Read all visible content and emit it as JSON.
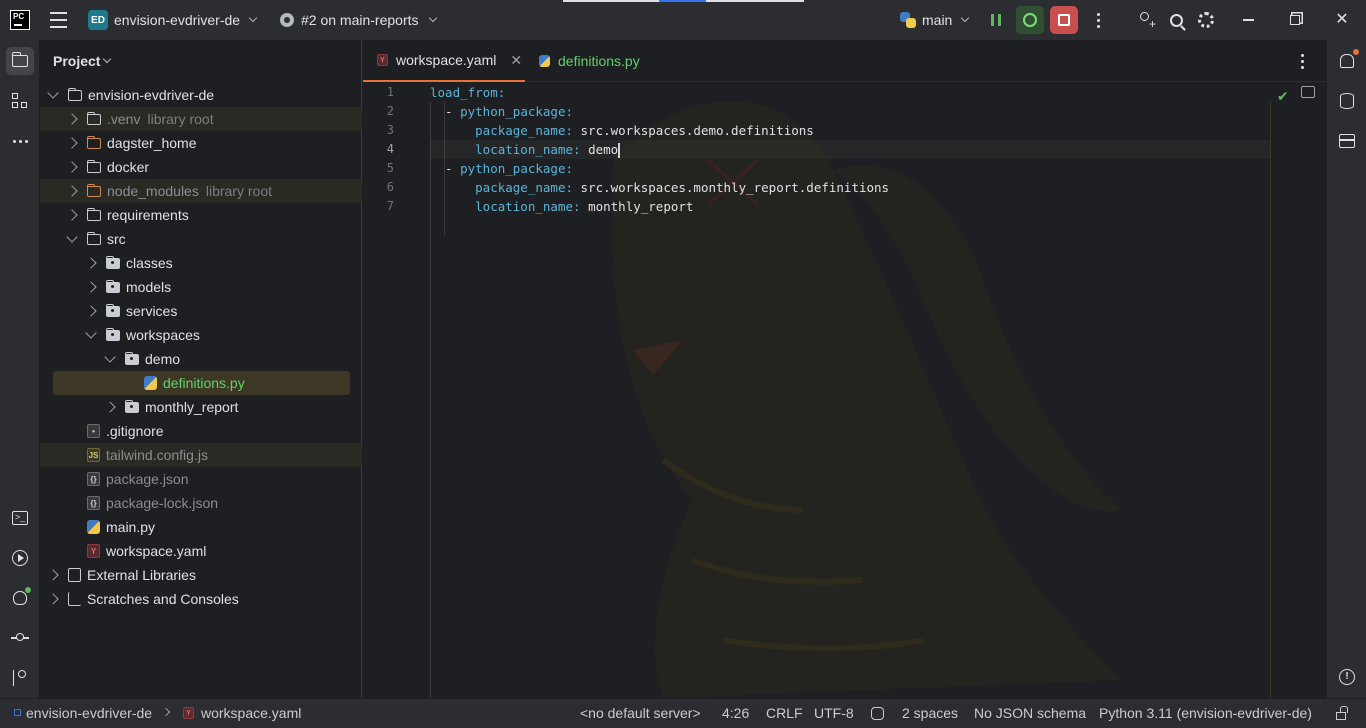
{
  "titlebar": {
    "logo_text": "PC",
    "project_badge": "ED",
    "project_name": "envision-evdriver-de",
    "vcs_label": "#2 on main-reports",
    "branch": "main"
  },
  "project_panel": {
    "header": "Project",
    "tree": [
      {
        "label": "envision-evdriver-de",
        "kind": "folder",
        "depth": 0,
        "arrow": "open"
      },
      {
        "label": ".venv",
        "hint": "library root",
        "kind": "folder",
        "depth": 1,
        "arrow": "closed",
        "style": "excluded"
      },
      {
        "label": "dagster_home",
        "kind": "folder-orange",
        "depth": 1,
        "arrow": "closed"
      },
      {
        "label": "docker",
        "kind": "folder",
        "depth": 1,
        "arrow": "closed"
      },
      {
        "label": "node_modules",
        "hint": "library root",
        "kind": "folder-orange",
        "depth": 1,
        "arrow": "closed",
        "style": "excluded"
      },
      {
        "label": "requirements",
        "kind": "folder",
        "depth": 1,
        "arrow": "closed"
      },
      {
        "label": "src",
        "kind": "folder",
        "depth": 1,
        "arrow": "open"
      },
      {
        "label": "classes",
        "kind": "package",
        "depth": 2,
        "arrow": "closed"
      },
      {
        "label": "models",
        "kind": "package",
        "depth": 2,
        "arrow": "closed"
      },
      {
        "label": "services",
        "kind": "package",
        "depth": 2,
        "arrow": "closed"
      },
      {
        "label": "workspaces",
        "kind": "package",
        "depth": 2,
        "arrow": "open"
      },
      {
        "label": "demo",
        "kind": "package",
        "depth": 3,
        "arrow": "open"
      },
      {
        "label": "definitions.py",
        "kind": "py",
        "depth": 4,
        "arrow": "none",
        "style": "selected"
      },
      {
        "label": "monthly_report",
        "kind": "package",
        "depth": 3,
        "arrow": "closed"
      },
      {
        "label": ".gitignore",
        "kind": "git",
        "depth": 1,
        "arrow": "none"
      },
      {
        "label": "tailwind.config.js",
        "kind": "js",
        "depth": 1,
        "arrow": "none",
        "style": "excluded-muted"
      },
      {
        "label": "package.json",
        "kind": "json",
        "depth": 1,
        "arrow": "none",
        "style": "muted"
      },
      {
        "label": "package-lock.json",
        "kind": "json",
        "depth": 1,
        "arrow": "none",
        "style": "muted"
      },
      {
        "label": "main.py",
        "kind": "py",
        "depth": 1,
        "arrow": "none"
      },
      {
        "label": "workspace.yaml",
        "kind": "yaml",
        "depth": 1,
        "arrow": "none"
      },
      {
        "label": "External Libraries",
        "kind": "lib",
        "depth": 0,
        "arrow": "closed"
      },
      {
        "label": "Scratches and Consoles",
        "kind": "scratch",
        "depth": 0,
        "arrow": "closed"
      }
    ]
  },
  "editor": {
    "tabs": [
      {
        "label": "workspace.yaml",
        "icon": "yaml",
        "active": true
      },
      {
        "label": "definitions.py",
        "icon": "py",
        "active": false
      }
    ],
    "lines": [
      {
        "n": "1",
        "key": "load_from",
        "sep": ":",
        "value": "",
        "prefix": ""
      },
      {
        "n": "2",
        "key": "python_package",
        "sep": ":",
        "value": "",
        "prefix": "  - "
      },
      {
        "n": "3",
        "key": "package_name",
        "sep": ": ",
        "value": "src.workspaces.demo.definitions",
        "prefix": "      "
      },
      {
        "n": "4",
        "key": "location_name",
        "sep": ": ",
        "value": "demo",
        "prefix": "      ",
        "current": true
      },
      {
        "n": "5",
        "key": "python_package",
        "sep": ":",
        "value": "",
        "prefix": "  - "
      },
      {
        "n": "6",
        "key": "package_name",
        "sep": ": ",
        "value": "src.workspaces.monthly_report.definitions",
        "prefix": "      "
      },
      {
        "n": "7",
        "key": "location_name",
        "sep": ": ",
        "value": "monthly_report",
        "prefix": "      "
      }
    ]
  },
  "statusbar": {
    "breadcrumb_project": "envision-evdriver-de",
    "breadcrumb_file": "workspace.yaml",
    "server": "<no default server>",
    "position": "4:26",
    "line_ending": "CRLF",
    "encoding": "UTF-8",
    "indent": "2 spaces",
    "schema": "No JSON schema",
    "interpreter": "Python 3.11 (envision-evdriver-de)"
  },
  "colors": {
    "background": "#1e1f22",
    "panel": "#2b2d30",
    "yaml_key": "#5ab4d8",
    "active_tab_underline": "#e8713a",
    "selected_row": "#3d3726",
    "modified_file": "#62d16a",
    "stop_button": "#c94f4f",
    "accent_blue": "#3574f0"
  },
  "icons": {
    "titlebar": [
      "hamburger-icon",
      "github-icon",
      "python-icon",
      "pause-icon",
      "debug-icon",
      "stop-icon",
      "more-icon",
      "add-user-icon",
      "search-icon",
      "gear-icon",
      "minimize-icon",
      "restore-icon",
      "close-icon"
    ],
    "left_strip": [
      "folder-icon",
      "structure-icon",
      "more-icon",
      "terminal-icon",
      "run-icon",
      "debug-icon",
      "commit-icon",
      "git-icon"
    ],
    "right_strip": [
      "bell-icon",
      "database-icon",
      "list-icon",
      "warning-icon"
    ]
  }
}
